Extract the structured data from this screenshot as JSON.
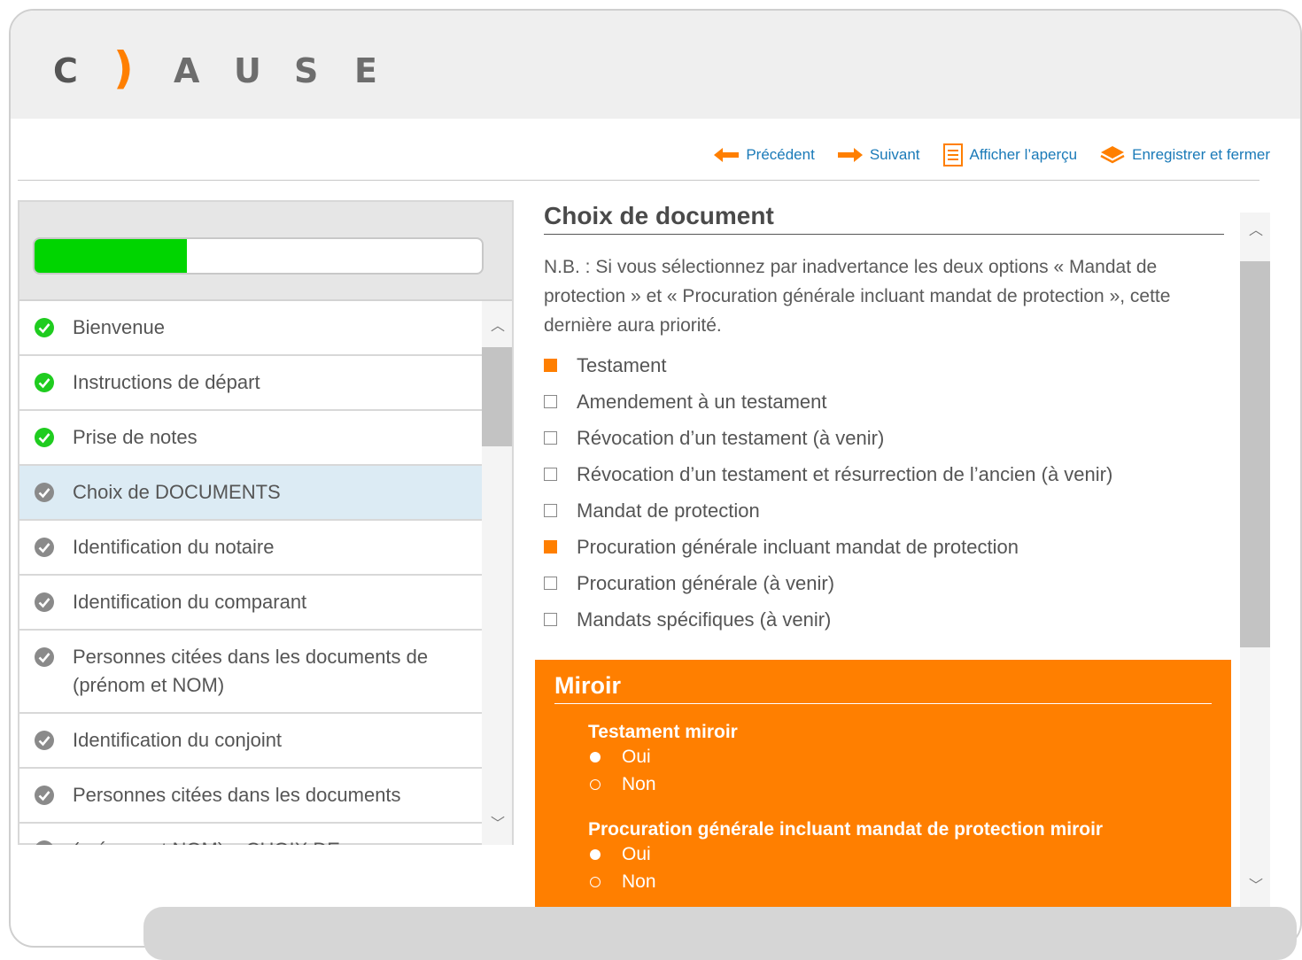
{
  "logo": {
    "letters": [
      "C",
      ")",
      "A",
      "U",
      "S",
      "E"
    ]
  },
  "toolbar": {
    "previous": "Précédent",
    "next": "Suivant",
    "preview": "Afficher l’aperçu",
    "save_close": "Enregistrer et fermer"
  },
  "progress": {
    "value": 0.34,
    "color": "#00d500"
  },
  "nav": {
    "items": [
      {
        "label": "Bienvenue",
        "done": true
      },
      {
        "label": "Instructions de départ",
        "done": true
      },
      {
        "label": "Prise de notes",
        "done": true
      },
      {
        "label": "Choix de DOCUMENTS",
        "done": false,
        "active": true
      },
      {
        "label": "Identification du notaire",
        "done": false
      },
      {
        "label": "Identification du comparant",
        "done": false
      },
      {
        "label": "Personnes citées dans les documents de (prénom et NOM)",
        "done": false
      },
      {
        "label": "Identification du conjoint",
        "done": false
      },
      {
        "label": "Personnes citées dans les documents",
        "done": false
      },
      {
        "label": "(prénom et NOM) – CHOIX DE",
        "done": false
      }
    ]
  },
  "main": {
    "title": "Choix de document",
    "note": "N.B. : Si vous sélectionnez par inadvertance les deux options « Mandat de protection » et « Procuration générale incluant mandat de protection », cette dernière aura priorité.",
    "options": [
      {
        "label": "Testament",
        "checked": true
      },
      {
        "label": "Amendement à un testament",
        "checked": false
      },
      {
        "label": "Révocation d’un testament (à venir)",
        "checked": false
      },
      {
        "label": "Révocation d’un testament et résurrection de l’ancien (à venir)",
        "checked": false
      },
      {
        "label": "Mandat de protection",
        "checked": false
      },
      {
        "label": "Procuration générale incluant mandat de protection",
        "checked": true
      },
      {
        "label": "Procuration générale (à venir)",
        "checked": false
      },
      {
        "label": "Mandats spécifiques (à venir)",
        "checked": false
      }
    ]
  },
  "miroir": {
    "title": "Miroir",
    "q1": {
      "label": "Testament miroir",
      "yes": "Oui",
      "no": "Non",
      "selected": "yes"
    },
    "q2": {
      "label": "Procuration générale incluant mandat de protection miroir",
      "yes": "Oui",
      "no": "Non",
      "selected": "yes"
    }
  },
  "colors": {
    "accent": "#ff7f00",
    "link": "#1a7ab8",
    "active_row": "#dcebf4"
  },
  "icons": [
    "arrow-left-icon",
    "arrow-right-icon",
    "document-preview-icon",
    "layers-save-icon",
    "check-circle-icon",
    "chevron-up-icon",
    "chevron-down-icon"
  ]
}
